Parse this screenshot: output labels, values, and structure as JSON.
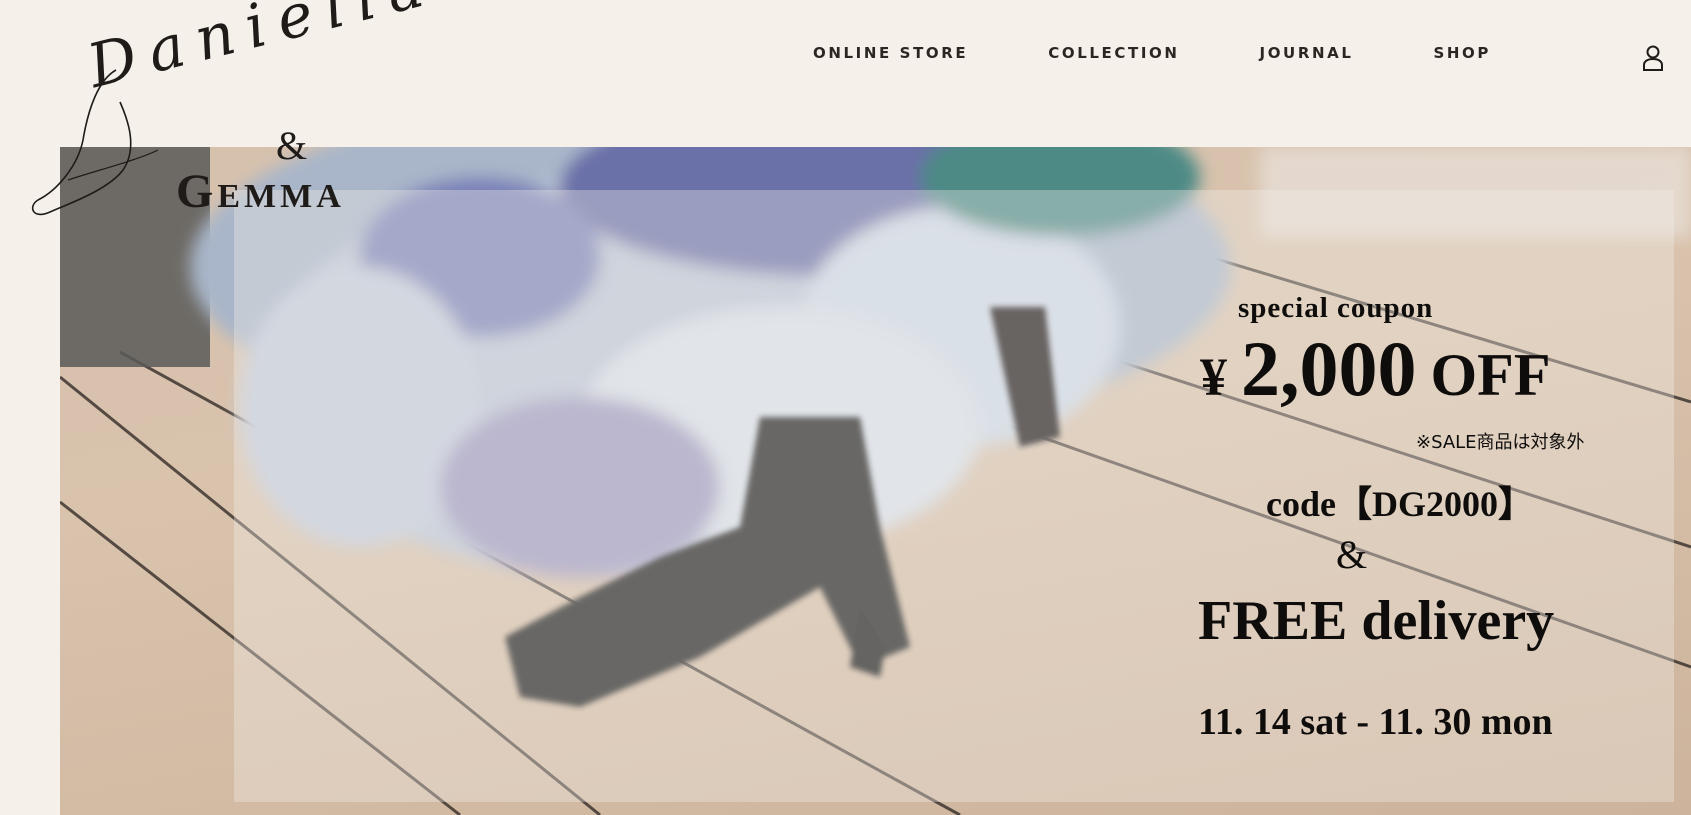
{
  "brand": {
    "script": "Daniella",
    "ampersand": "&",
    "name": "Gemma"
  },
  "nav": {
    "items": [
      {
        "label": "ONLINE STORE"
      },
      {
        "label": "COLLECTION"
      },
      {
        "label": "JOURNAL"
      },
      {
        "label": "SHOP"
      }
    ],
    "account_icon": "user-icon"
  },
  "promo": {
    "subtitle": "special coupon",
    "currency": "¥",
    "amount": "2,000",
    "off": "OFF",
    "note": "※SALE商品は対象外",
    "code": "code【DG2000】",
    "ampersand": "&",
    "free_delivery": "FREE delivery",
    "dates": "11. 14 sat - 11. 30 mon"
  },
  "colors": {
    "background": "#f5f0ea",
    "text": "#1e1b18"
  }
}
